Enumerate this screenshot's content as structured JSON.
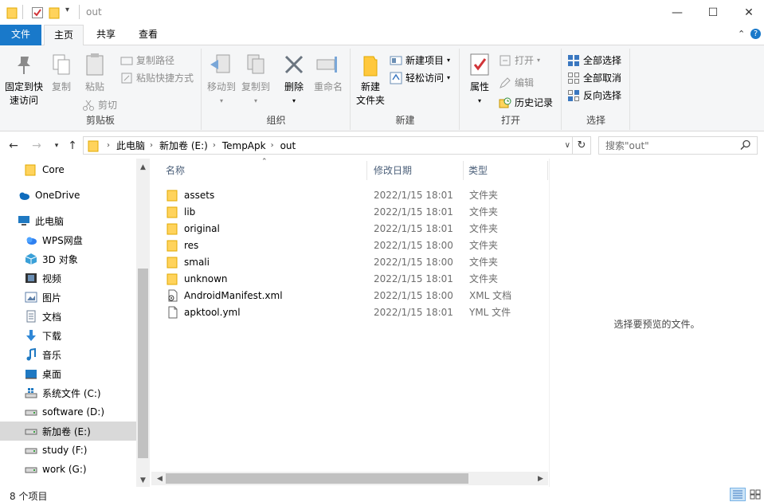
{
  "window": {
    "title": "out",
    "qat_more": "▾",
    "controls": {
      "minimize": "—",
      "maximize": "☐",
      "close": "✕"
    }
  },
  "ribbon_tabs": [
    {
      "label": "文件"
    },
    {
      "label": "主页"
    },
    {
      "label": "共享"
    },
    {
      "label": "查看"
    }
  ],
  "ribbon_right": {
    "collapse": "⌃",
    "help": "?"
  },
  "ribbon": {
    "clipboard": {
      "label": "剪贴板",
      "pin_line1": "固定到快",
      "pin_line2": "速访问",
      "copy": "复制",
      "paste": "粘贴",
      "copy_path": "复制路径",
      "paste_shortcut": "粘贴快捷方式",
      "cut": "剪切"
    },
    "organize": {
      "label": "组织",
      "move_to": "移动到",
      "copy_to": "复制到",
      "delete": "删除",
      "rename": "重命名"
    },
    "new": {
      "label": "新建",
      "new_folder_line1": "新建",
      "new_folder_line2": "文件夹",
      "new_item": "新建项目",
      "easy_access": "轻松访问"
    },
    "open": {
      "label": "打开",
      "properties": "属性",
      "open": "打开",
      "edit": "编辑",
      "history": "历史记录"
    },
    "select": {
      "label": "选择",
      "select_all": "全部选择",
      "select_none": "全部取消",
      "invert": "反向选择"
    }
  },
  "address": {
    "crumbs": [
      "此电脑",
      "新加卷 (E:)",
      "TempApk",
      "out"
    ],
    "search_placeholder": "搜索\"out\""
  },
  "nav_pane": {
    "items": [
      {
        "label": "Core",
        "icon": "folder-icon",
        "color": "#ffd35c"
      },
      {
        "label": "OneDrive",
        "icon": "cloud-icon",
        "color": "#0f6cbd"
      },
      {
        "label": "此电脑",
        "icon": "computer-icon",
        "color": "#1f79c2"
      },
      {
        "label": "WPS网盘",
        "icon": "wps-cloud-icon",
        "color": "#2e7ff0"
      },
      {
        "label": "3D 对象",
        "icon": "cube-icon",
        "color": "#3aa0d8"
      },
      {
        "label": "视频",
        "icon": "video-icon",
        "color": "#333333"
      },
      {
        "label": "图片",
        "icon": "picture-icon",
        "color": "#5b7ea8"
      },
      {
        "label": "文档",
        "icon": "document-icon",
        "color": "#6d7f95"
      },
      {
        "label": "下载",
        "icon": "download-icon",
        "color": "#2f87d6"
      },
      {
        "label": "音乐",
        "icon": "music-icon",
        "color": "#1f79c2"
      },
      {
        "label": "桌面",
        "icon": "desktop-icon",
        "color": "#1f79c2"
      },
      {
        "label": "系统文件 (C:)",
        "icon": "drive-windows-icon",
        "color": "#4c4c4c"
      },
      {
        "label": "software (D:)",
        "icon": "drive-icon",
        "color": "#4c4c4c"
      },
      {
        "label": "新加卷 (E:)",
        "icon": "drive-icon",
        "color": "#4c4c4c"
      },
      {
        "label": "study (F:)",
        "icon": "drive-icon",
        "color": "#4c4c4c"
      },
      {
        "label": "work (G:)",
        "icon": "drive-icon",
        "color": "#4c4c4c"
      }
    ]
  },
  "file_list": {
    "columns": {
      "name": "名称",
      "date": "修改日期",
      "type": "类型"
    },
    "rows": [
      {
        "name": "assets",
        "date": "2022/1/15 18:01",
        "type": "文件夹",
        "icon": "folder-icon"
      },
      {
        "name": "lib",
        "date": "2022/1/15 18:01",
        "type": "文件夹",
        "icon": "folder-icon"
      },
      {
        "name": "original",
        "date": "2022/1/15 18:01",
        "type": "文件夹",
        "icon": "folder-icon"
      },
      {
        "name": "res",
        "date": "2022/1/15 18:00",
        "type": "文件夹",
        "icon": "folder-icon"
      },
      {
        "name": "smali",
        "date": "2022/1/15 18:00",
        "type": "文件夹",
        "icon": "folder-icon"
      },
      {
        "name": "unknown",
        "date": "2022/1/15 18:01",
        "type": "文件夹",
        "icon": "folder-icon"
      },
      {
        "name": "AndroidManifest.xml",
        "date": "2022/1/15 18:00",
        "type": "XML 文档",
        "icon": "xml-file-icon"
      },
      {
        "name": "apktool.yml",
        "date": "2022/1/15 18:01",
        "type": "YML 文件",
        "icon": "file-icon"
      }
    ]
  },
  "preview": {
    "text": "选择要预览的文件。"
  },
  "status": {
    "text": "8 个项目"
  },
  "colors": {
    "accent": "#1979ca",
    "folder": "#ffd35c",
    "selected_nav": "#d9d9d9"
  }
}
